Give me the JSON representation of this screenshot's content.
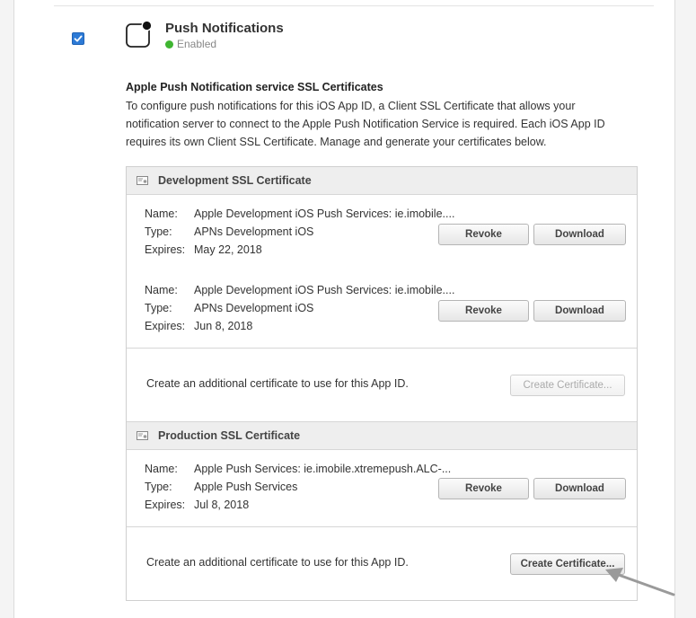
{
  "feature": {
    "title": "Push Notifications",
    "status": "Enabled",
    "checked": true
  },
  "section": {
    "heading": "Apple Push Notification service SSL Certificates",
    "description": "To configure push notifications for this iOS App ID, a Client SSL Certificate that allows your notification server to connect to the Apple Push Notification Service is required. Each iOS App ID requires its own Client SSL Certificate. Manage and generate your certificates below."
  },
  "labels": {
    "name": "Name:",
    "type": "Type:",
    "expires": "Expires:",
    "revoke": "Revoke",
    "download": "Download",
    "create_certificate": "Create Certificate...",
    "create_additional": "Create an additional certificate to use for this App ID."
  },
  "development": {
    "header": "Development SSL Certificate",
    "certificates": [
      {
        "name": "Apple Development iOS Push Services: ie.imobile....",
        "type": "APNs Development iOS",
        "expires": "May 22, 2018"
      },
      {
        "name": "Apple Development iOS Push Services: ie.imobile....",
        "type": "APNs Development iOS",
        "expires": "Jun 8, 2018"
      }
    ],
    "create_enabled": false
  },
  "production": {
    "header": "Production SSL Certificate",
    "certificates": [
      {
        "name": "Apple Push Services: ie.imobile.xtremepush.ALC-...",
        "type": "Apple Push Services",
        "expires": "Jul 8, 2018"
      }
    ],
    "create_enabled": true
  },
  "colors": {
    "status_green": "#3fb531",
    "checkbox_blue": "#2d7ad6",
    "panel_header_bg": "#eeeeee"
  },
  "icons": [
    "push-notification-icon",
    "certificate-icon",
    "checkmark-icon",
    "pointer-arrow-icon"
  ]
}
